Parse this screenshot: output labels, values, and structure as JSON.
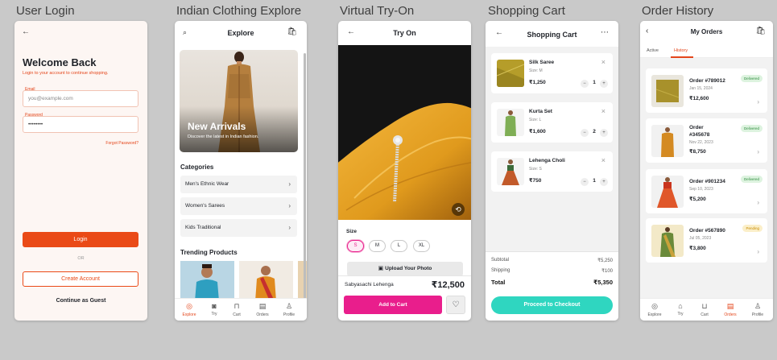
{
  "captions": [
    "User Login",
    "Indian Clothing Explore",
    "Virtual Try-On",
    "Shopping Cart",
    "Order History"
  ],
  "colors": {
    "accent_orange": "#ea4a17",
    "accent_pink": "#e91e8c",
    "accent_teal": "#2fd6c0",
    "delivered": "#2e8b3e",
    "pending": "#c78a00"
  },
  "login": {
    "back_icon": "arrow-left-icon",
    "title": "Welcome Back",
    "subtitle": "Login to your account to continue shopping.",
    "email_label": "Email",
    "email_placeholder": "you@example.com",
    "password_label": "Password",
    "password_value": "••••••••",
    "forgot": "Forgot Password?",
    "login_btn": "Login",
    "or": "OR",
    "create_btn": "Create Account",
    "guest": "Continue as Guest"
  },
  "explore": {
    "title": "Explore",
    "hero_title": "New Arrivals",
    "hero_sub": "Discover the latest in Indian fashion.",
    "categories_heading": "Categories",
    "categories": [
      "Men's Ethnic Wear",
      "Women's Sarees",
      "Kids Traditional"
    ],
    "trending_heading": "Trending Products",
    "tabs": [
      {
        "label": "Explore",
        "icon": "compass-icon"
      },
      {
        "label": "Try",
        "icon": "camera-icon"
      },
      {
        "label": "Cart",
        "icon": "bag-icon"
      },
      {
        "label": "Orders",
        "icon": "receipt-icon"
      },
      {
        "label": "Profile",
        "icon": "user-icon"
      }
    ]
  },
  "tryon": {
    "title": "Try On",
    "size_heading": "Size",
    "sizes": [
      "S",
      "M",
      "L",
      "XL"
    ],
    "selected_size": "S",
    "upload": "Upload Your Photo",
    "product_name": "Sabyasachi Lehenga",
    "product_price": "₹12,500",
    "add_btn": "Add to Cart"
  },
  "cart": {
    "title": "Shopping Cart",
    "items": [
      {
        "name": "Silk Saree",
        "size": "Size: M",
        "price": "₹1,250",
        "qty": "1"
      },
      {
        "name": "Kurta Set",
        "size": "Size: L",
        "price": "₹1,600",
        "qty": "2"
      },
      {
        "name": "Lehenga Choli",
        "size": "Size: S",
        "price": "₹750",
        "qty": "1"
      }
    ],
    "subtotal_label": "Subtotal",
    "subtotal": "₹5,250",
    "shipping_label": "Shipping",
    "shipping": "₹100",
    "total_label": "Total",
    "total": "₹5,350",
    "checkout_btn": "Proceed to Checkout"
  },
  "orders": {
    "title": "My Orders",
    "tabs": [
      "Active",
      "History"
    ],
    "active_tab": "History",
    "list": [
      {
        "id_line1": "Order #789012",
        "id_line2": "",
        "date": "Jan 15, 2024",
        "price": "₹12,600",
        "status": "Delivered"
      },
      {
        "id_line1": "Order",
        "id_line2": "#345678",
        "date": "Nov 22, 2023",
        "price": "₹8,750",
        "status": "Delivered"
      },
      {
        "id_line1": "Order #901234",
        "id_line2": "",
        "date": "Sep 10, 2023",
        "price": "₹5,200",
        "status": "Delivered"
      },
      {
        "id_line1": "Order #567890",
        "id_line2": "",
        "date": "Jul 05, 2023",
        "price": "₹3,800",
        "status": "Pending"
      }
    ],
    "tabbar": [
      {
        "label": "Explore",
        "icon": "compass-icon"
      },
      {
        "label": "Try",
        "icon": "hanger-icon"
      },
      {
        "label": "Cart",
        "icon": "cart-icon"
      },
      {
        "label": "Orders",
        "icon": "receipt-icon"
      },
      {
        "label": "Profile",
        "icon": "user-icon"
      }
    ]
  }
}
